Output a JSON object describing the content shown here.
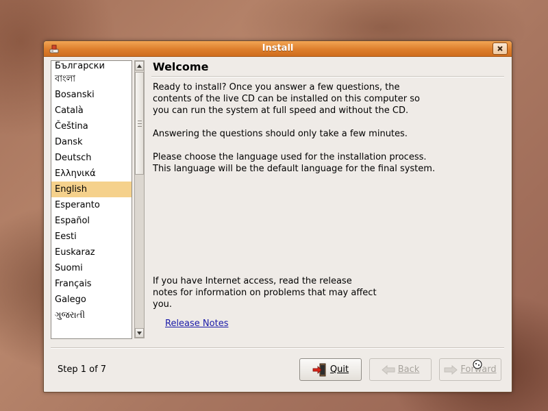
{
  "window": {
    "title": "Install",
    "close_icon": "close-icon"
  },
  "languages": {
    "items": [
      "Български",
      "বাংলা",
      "Bosanski",
      "Català",
      "Čeština",
      "Dansk",
      "Deutsch",
      "Ελληνικά",
      "English",
      "Esperanto",
      "Español",
      "Eesti",
      "Euskaraz",
      "Suomi",
      "Français",
      "Galego",
      "ગુજરાતી"
    ],
    "selected": "English"
  },
  "main": {
    "heading": "Welcome",
    "intro_line1": "Ready to install? Once you answer a few questions, the",
    "intro_line2": "contents of the live CD can be installed on this computer so",
    "intro_line3": "you can run the system at full speed and without the CD.",
    "questions_text": "Answering the questions should only take a few minutes.",
    "choose_line1": "Please choose the language used for the installation process.",
    "choose_line2": "This language will be the default language for the final system.",
    "internet_line1": "If you have Internet access, read the release",
    "internet_line2": "notes for information on problems that may affect",
    "internet_line3": "you.",
    "release_notes_link": "Release Notes"
  },
  "footer": {
    "step_text": "Step 1 of 7",
    "quit_label": "Quit",
    "back_label": "Back",
    "forward_label": "Forward"
  },
  "colors": {
    "titlebar": "#dd7e2c",
    "selection": "#f5d18c",
    "link": "#1a1aa8"
  }
}
